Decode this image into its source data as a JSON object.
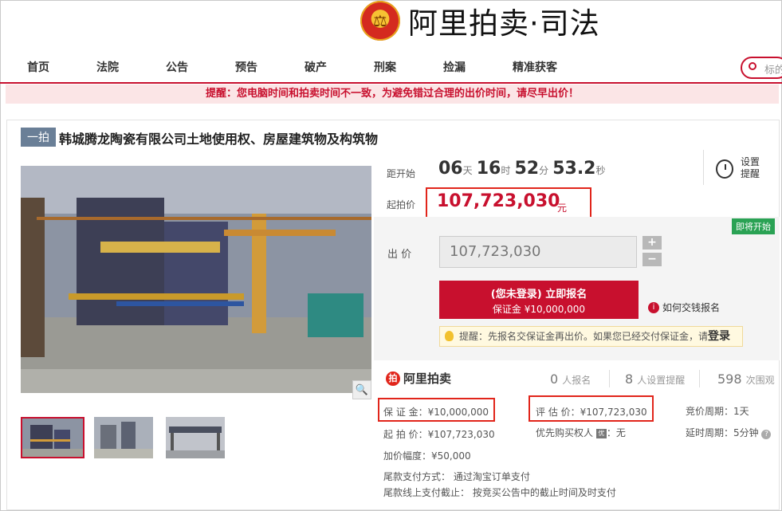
{
  "header": {
    "emblem_glyph": "⚖",
    "logo_text": "阿里拍卖·司法",
    "nav": [
      "首页",
      "法院",
      "公告",
      "预告",
      "破产",
      "刑案",
      "捡漏",
      "精准获客"
    ],
    "search_placeholder": "标的"
  },
  "notice": "提醒：您电脑时间和拍卖时间不一致，为避免错过合理的出价时间，请尽早出价！",
  "item": {
    "round_tag": "一拍",
    "title": "韩城腾龙陶瓷有限公司土地使用权、房屋建筑物及构筑物"
  },
  "countdown": {
    "label": "距开始",
    "days": "06",
    "days_unit": "天",
    "hours": "16",
    "hours_unit": "时",
    "minutes": "52",
    "minutes_unit": "分",
    "seconds": "53.2",
    "seconds_unit": "秒"
  },
  "reminder": {
    "line1": "设置",
    "line2": "提醒"
  },
  "start_price": {
    "label": "起拍价",
    "value": "107,723,030",
    "unit": "元"
  },
  "badge_soon": "即将开始",
  "bid": {
    "label": "出 价",
    "value": "107,723,030",
    "plus": "+",
    "minus": "−"
  },
  "signup": {
    "line1": "(您未登录) 立即报名",
    "line2": "保证金 ¥10,000,000"
  },
  "how_pay": {
    "icon": "i",
    "text": "如何交钱报名"
  },
  "tip": {
    "text": "提醒：先报名交保证金再出价。如果您已经交付保证金，请",
    "login": "登录"
  },
  "stats": {
    "brand_icon": "拍",
    "brand": "阿里拍卖",
    "signups_num": "0",
    "signups_label": "人报名",
    "reminders_num": "8",
    "reminders_label": "人设置提醒",
    "views_num": "598",
    "views_label": "次围观"
  },
  "details": {
    "deposit": "保 证 金：¥10,000,000",
    "appraisal": "评 估 价：¥107,723,030",
    "cycle": "竞价周期：1天",
    "start": "起 拍 价：¥107,723,030",
    "priority_label": "优先购买权人",
    "priority_icon": "优",
    "priority_value": "：无",
    "delay": "延时周期：5分钟",
    "delay_help": "?",
    "increment": "加价幅度：¥50,000",
    "final_pay": "尾款支付方式：  通过淘宝订单支付",
    "final_deadline": "尾款线上支付截止：  按竞买公告中的截止时间及时支付"
  },
  "zoom_icon_glyph": "🔍",
  "colors": {
    "brand_red": "#c8102e",
    "tag_blue": "#6a7f97",
    "soon_green": "#2aa254"
  }
}
